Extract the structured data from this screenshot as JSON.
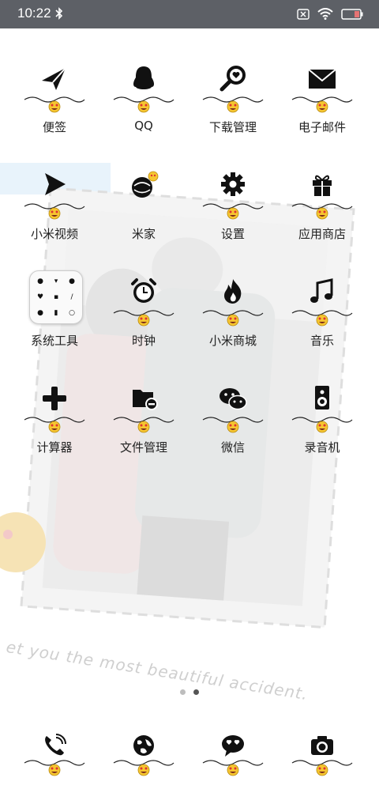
{
  "status_bar": {
    "time": "10:22",
    "icons": [
      "bluetooth-icon",
      "sim-x-icon",
      "wifi-icon",
      "battery-icon"
    ],
    "battery_color": "#e57373"
  },
  "wallpaper": {
    "tagline": "et you the most beautiful accident."
  },
  "apps": [
    {
      "label": "便签",
      "icon": "paper-plane-icon"
    },
    {
      "label": "QQ",
      "icon": "penguin-icon"
    },
    {
      "label": "下载管理",
      "icon": "magnifier-heart-icon"
    },
    {
      "label": "电子邮件",
      "icon": "envelope-icon"
    },
    {
      "label": "小米视频",
      "icon": "play-arrow-icon"
    },
    {
      "label": "米家",
      "icon": "sphere-icon"
    },
    {
      "label": "设置",
      "icon": "gear-icon"
    },
    {
      "label": "应用商店",
      "icon": "gift-icon"
    },
    {
      "label": "系统工具",
      "icon": "folder-icon"
    },
    {
      "label": "时钟",
      "icon": "alarm-clock-icon"
    },
    {
      "label": "小米商城",
      "icon": "flame-icon"
    },
    {
      "label": "音乐",
      "icon": "music-note-icon"
    },
    {
      "label": "计算器",
      "icon": "plus-icon"
    },
    {
      "label": "文件管理",
      "icon": "file-folder-icon"
    },
    {
      "label": "微信",
      "icon": "chat-bubbles-icon"
    },
    {
      "label": "录音机",
      "icon": "speaker-icon"
    }
  ],
  "page_indicator": {
    "count": 2,
    "active": 2
  },
  "dock": [
    {
      "icon": "phone-icon"
    },
    {
      "icon": "browser-globe-icon"
    },
    {
      "icon": "message-heart-icon"
    },
    {
      "icon": "camera-icon"
    }
  ],
  "colors": {
    "icon": "#111111",
    "emoji": "#f6c630",
    "status_bar": "#5d6066"
  }
}
